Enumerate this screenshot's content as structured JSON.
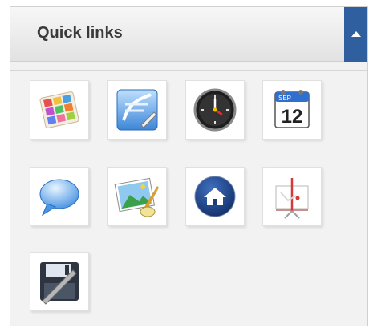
{
  "panel": {
    "title": "Quick links",
    "collapse_icon": "chevron-up-icon"
  },
  "links": [
    {
      "icon": "palette-icon"
    },
    {
      "icon": "text-editor-icon"
    },
    {
      "icon": "clock-icon"
    },
    {
      "icon": "calendar-icon",
      "calendar": {
        "month": "SEP",
        "day": "12"
      }
    },
    {
      "icon": "chat-bubble-icon"
    },
    {
      "icon": "image-editor-icon"
    },
    {
      "icon": "home-icon"
    },
    {
      "icon": "presentation-icon"
    },
    {
      "icon": "save-disk-icon"
    }
  ],
  "colors": {
    "accent": "#2f5f9f",
    "panel_bg": "#f2f2f2",
    "title_text": "#3a3a3a"
  }
}
